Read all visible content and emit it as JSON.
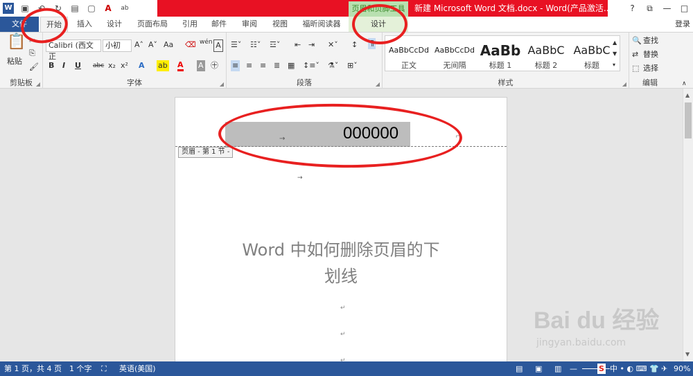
{
  "window": {
    "context_tab": "页眉和页脚工具",
    "title": "新建 Microsoft Word 文档.docx - Word(产品激活...",
    "controls": [
      "?",
      "⧉",
      "—",
      "□"
    ]
  },
  "tabs": [
    "文件",
    "开始",
    "插入",
    "设计",
    "页面布局",
    "引用",
    "邮件",
    "审阅",
    "视图",
    "福昕阅读器",
    "设计"
  ],
  "login": "登录",
  "ribbon": {
    "clipboard": {
      "paste": "粘贴",
      "label": "剪贴板"
    },
    "font": {
      "name": "Calibri (西文正",
      "size": "小初",
      "label": "字体",
      "aa": "Aa",
      "wen": "wén",
      "bold": "B",
      "italic": "I",
      "underline": "U",
      "strike": "abc",
      "sub": "x₂",
      "sup": "x²"
    },
    "paragraph": {
      "label": "段落"
    },
    "styles": {
      "label": "样式",
      "items": [
        {
          "sample": "AaBbCcDd",
          "name": "正文"
        },
        {
          "sample": "AaBbCcDd",
          "name": "无间隔"
        },
        {
          "sample": "AaBb",
          "name": "标题 1"
        },
        {
          "sample": "AaBbC",
          "name": "标题 2"
        },
        {
          "sample": "AaBbC",
          "name": "标题"
        }
      ]
    },
    "editing": {
      "find": "查找",
      "replace": "替换",
      "select": "选择",
      "label": "编辑"
    }
  },
  "document": {
    "header_text": "000000",
    "header_tag": "页眉 - 第 1 节 -",
    "body_title_line1": "Word 中如何删除页眉的下",
    "body_title_line2": "划线"
  },
  "status": {
    "page": "第 1 页，共 4 页",
    "words": "1 个字",
    "language": "英语(美国)",
    "zoom": "90%"
  },
  "watermark": {
    "brand": "Bai du 经验",
    "url": "jingyan.baidu.com"
  },
  "colors": {
    "accent": "#2b579a",
    "title_red": "#e81123",
    "annotation": "#e82020",
    "context_green": "#b8e0b0"
  }
}
